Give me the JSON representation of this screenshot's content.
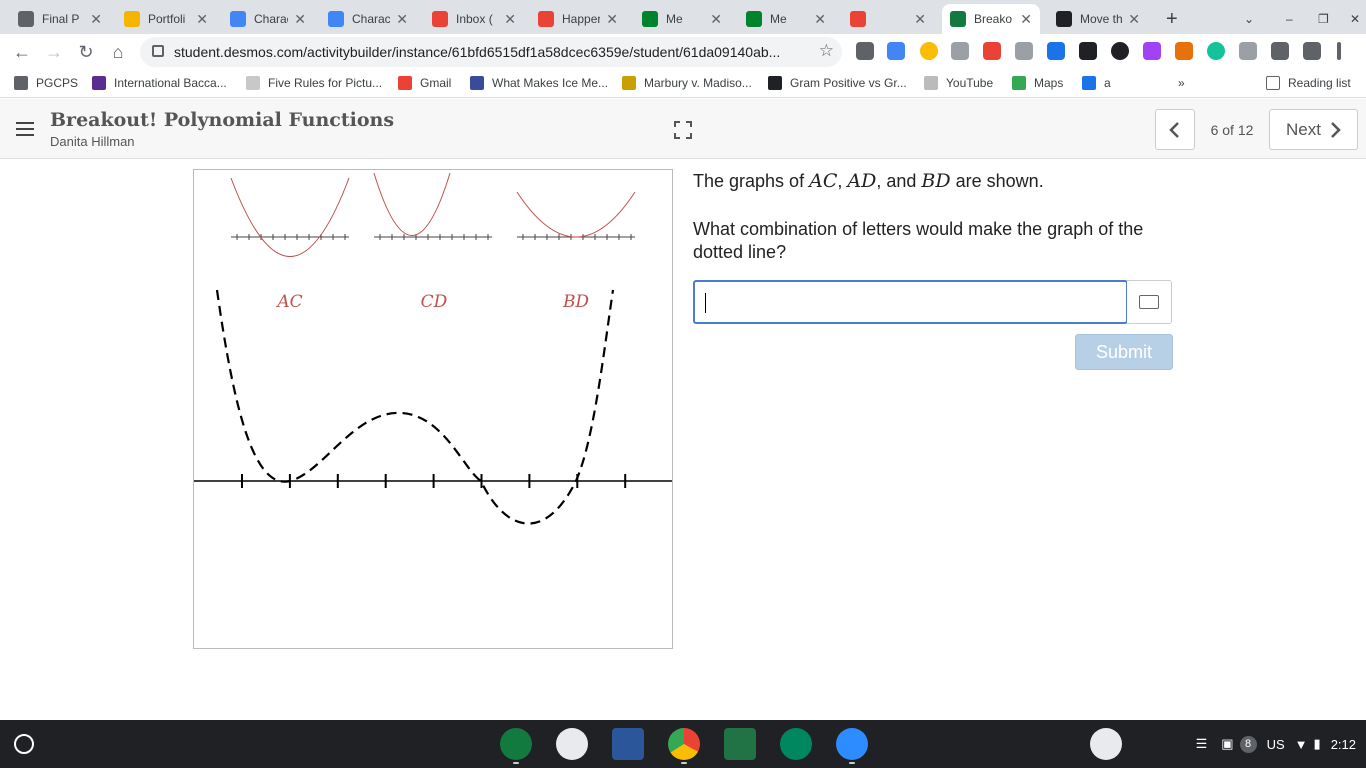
{
  "browser": {
    "tabs": [
      {
        "title": "Final P",
        "color": "#5f6368"
      },
      {
        "title": "Portfoli",
        "color": "#f4b400"
      },
      {
        "title": "Charac",
        "color": "#4285f4"
      },
      {
        "title": "Charac",
        "color": "#4285f4"
      },
      {
        "title": "Inbox (",
        "color": "#ea4335"
      },
      {
        "title": "Happen",
        "color": "#ea4335"
      },
      {
        "title": "Me",
        "color": "#00832d"
      },
      {
        "title": "Me",
        "color": "#00832d"
      },
      {
        "title": "",
        "color": "#ea4335"
      },
      {
        "title": "Breako",
        "color": "#127a3e"
      },
      {
        "title": "Move th",
        "color": "#202124"
      }
    ],
    "url": "student.desmos.com/activitybuilder/instance/61bfd6515df1a58dcec6359e/student/61da09140ab...",
    "bookmarks": [
      {
        "label": "PGCPS",
        "color": "#5f6368"
      },
      {
        "label": "International Bacca...",
        "color": "#5c2d91"
      },
      {
        "label": "Five Rules for Pictu...",
        "color": "#c8c8c8"
      },
      {
        "label": "Gmail",
        "color": "#ea4335"
      },
      {
        "label": "What Makes Ice Me...",
        "color": "#3c4a9c"
      },
      {
        "label": "Marbury v. Madiso...",
        "color": "#c8a000"
      },
      {
        "label": "Gram Positive vs Gr...",
        "color": "#202124"
      },
      {
        "label": "YouTube",
        "color": "#bbbbbb"
      },
      {
        "label": "Maps",
        "color": "#34a853"
      },
      {
        "label": "a",
        "color": "#1a73e8"
      }
    ],
    "reading_list": "Reading list",
    "more_bookmarks": "»"
  },
  "activity": {
    "title": "Breakout! Polynomial Functions",
    "teacher": "Danita Hillman",
    "page_indicator": "6 of 12",
    "next_label": "Next"
  },
  "graph": {
    "small_labels": [
      "AC",
      "CD",
      "BD"
    ],
    "label_color": "#c0504d"
  },
  "question": {
    "line1_pre": "The graphs of",
    "m1": "AC",
    "m2": "AD",
    "and": "and",
    "m3": "BD",
    "line1_post": "are shown.",
    "line2": "What combination of letters would make the graph of the dotted line?",
    "answer_value": "",
    "submit_label": "Submit"
  },
  "taskbar": {
    "notification_count": "8",
    "keyboard_layout": "US",
    "time": "2:12"
  }
}
